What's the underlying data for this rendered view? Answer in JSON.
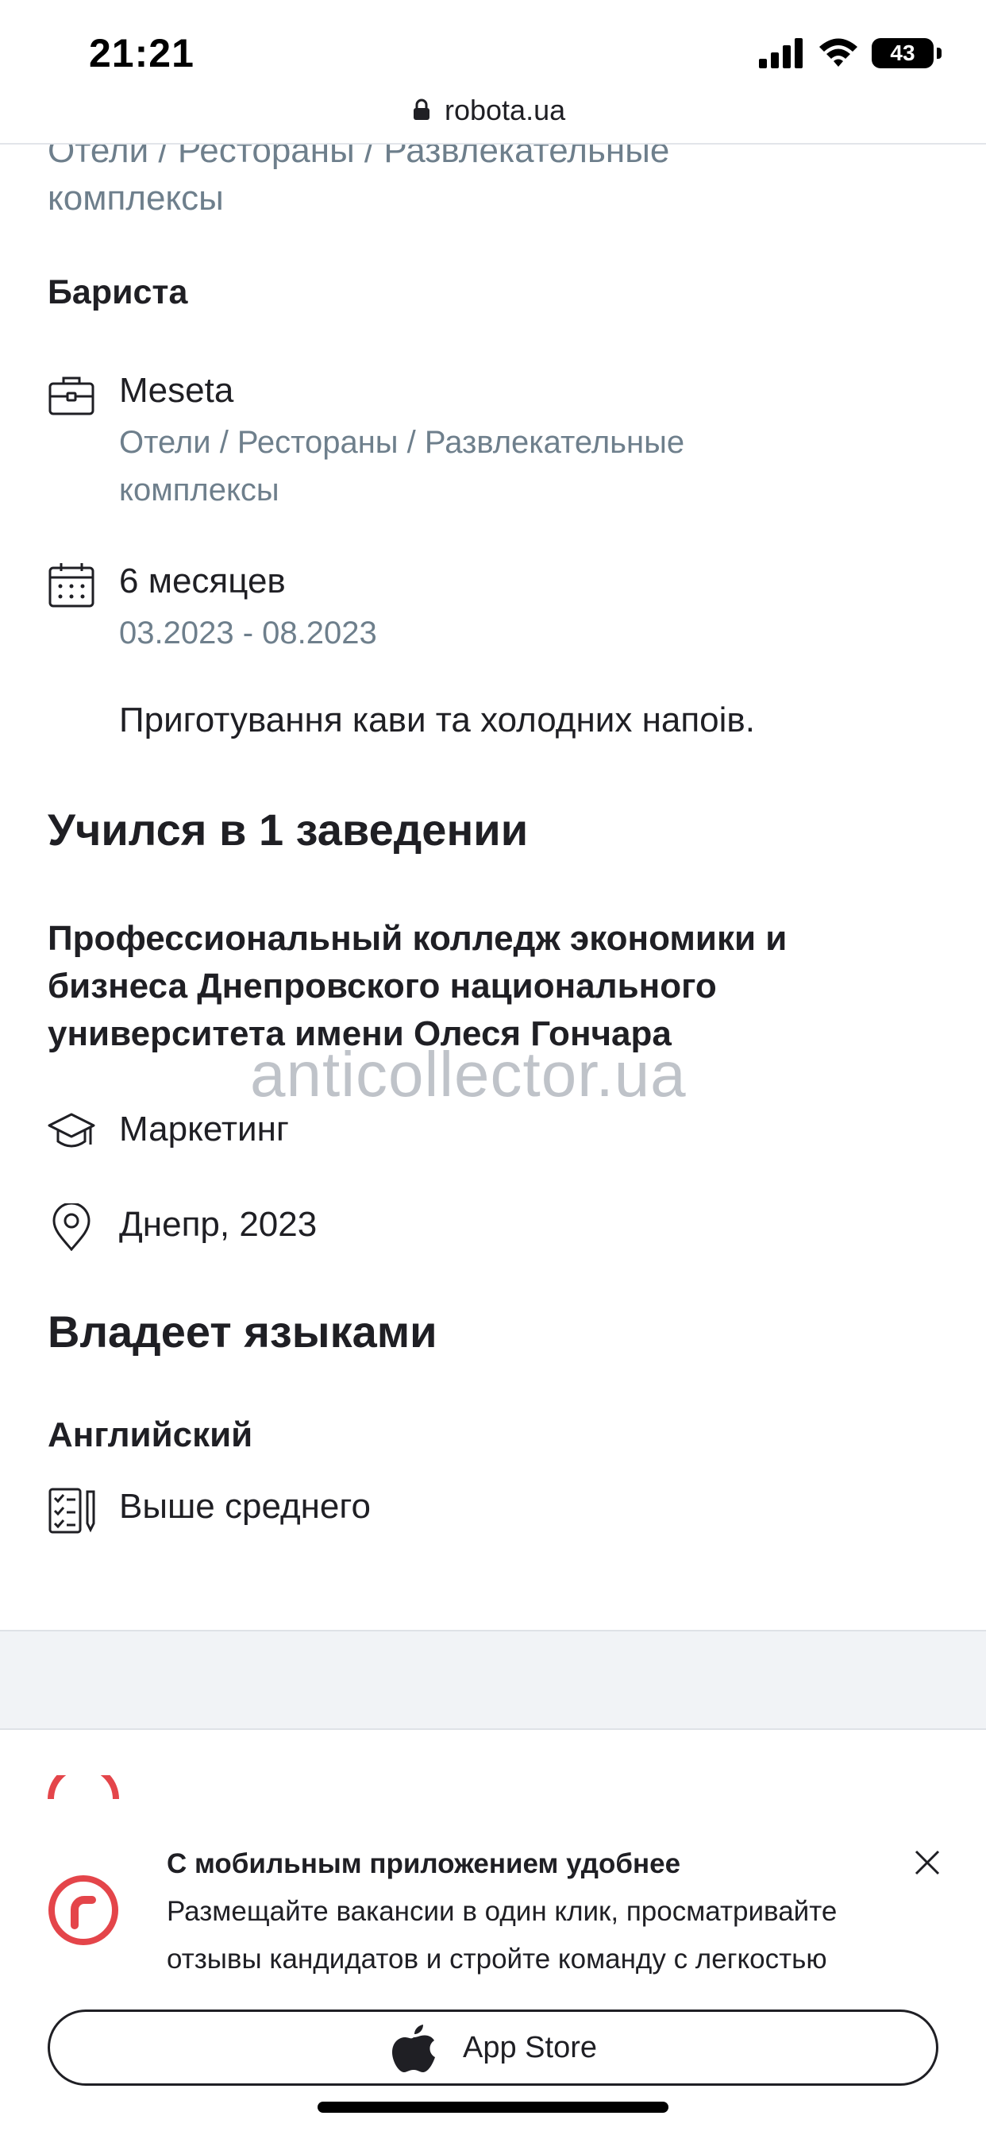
{
  "status_bar": {
    "time": "21:21",
    "battery": "43"
  },
  "browser": {
    "url": "robota.ua"
  },
  "experience": {
    "category_top": "Отели / Рестораны / Развлекательные комплексы",
    "position": "Бариста",
    "company": "Meseta",
    "company_category": "Отели / Рестораны / Развлекательные комплексы",
    "duration": "6 месяцев",
    "period": "03.2023 - 08.2023",
    "description": "Приготування кави та холодних напоів."
  },
  "education": {
    "section_title": "Учился в 1 заведении",
    "institution": "Профессиональный колледж экономики и бизнеса Днепровского национального университета имени Олеся Гончара",
    "specialty": "Маркетинг",
    "location_year": "Днепр, 2023"
  },
  "watermark": "anticollector.ua",
  "languages": {
    "section_title": "Владеет языками",
    "items": [
      {
        "name": "Английский",
        "level": "Выше среднего"
      }
    ]
  },
  "app_banner": {
    "title": "С мобильным приложением удобнее",
    "text": "Размещайте вакансии в один клик, просматривайте отзывы кандидатов и стройте команду с легкостью",
    "button_label": "App Store"
  },
  "colors": {
    "accent": "#e4454a",
    "muted_text": "#6e7f8c",
    "text": "#1f1f24"
  }
}
